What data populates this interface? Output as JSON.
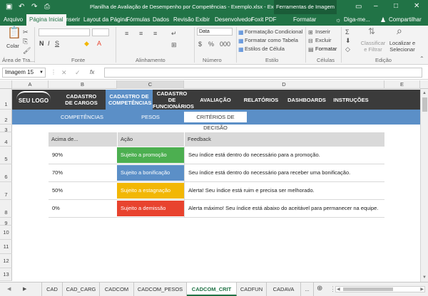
{
  "title_bar": {
    "document_title": "Planilha de Avaliação de Desempenho por Competências - Exemplo.xlsx - Excel",
    "context_tab": "Ferramentas de Imagem"
  },
  "ribbon_tabs": [
    "Arquivo",
    "Página Inicial",
    "Inserir",
    "Layout da Página",
    "Fórmulas",
    "Dados",
    "Revisão",
    "Exibir",
    "Desenvolvedor",
    "Foxit PDF",
    "Formatar"
  ],
  "tell_me": "Diga-me...",
  "share": "Compartilhar",
  "ribbon": {
    "paste": "Colar",
    "clipboard": "Área de Tra...",
    "font": "Fonte",
    "alignment": "Alinhamento",
    "number_format": "Data",
    "number": "Número",
    "cond_format": "Formatação Condicional",
    "format_table": "Formatar como Tabela",
    "cell_styles": "Estilos de Célula",
    "styles": "Estilo",
    "insert": "Inserir",
    "delete": "Excluir",
    "format": "Formatar",
    "cells": "Células",
    "sort_filter": "Classificar e Filtrar",
    "find_select": "Localizar e Selecionar",
    "editing": "Edição"
  },
  "formula_bar": {
    "name_box": "Imagem 15",
    "fx": "fx",
    "content": ""
  },
  "columns": [
    "A",
    "B",
    "C",
    "D",
    "E"
  ],
  "rows": [
    "1",
    "2",
    "3",
    "4",
    "5",
    "6",
    "7",
    "8",
    "9",
    "10",
    "11",
    "12",
    "13"
  ],
  "nav": {
    "logo": "SEU LOGO",
    "items": [
      "CADASTRO DE CARGOS",
      "CADASTRO DE COMPETÊNCIAS",
      "CADASTRO DE FUNCIONÁRIOS",
      "AVALIAÇÃO",
      "RELATÓRIOS",
      "DASHBOARDS",
      "INSTRUÇÕES"
    ]
  },
  "subnav": [
    "COMPETÊNCIAS",
    "PESOS",
    "CRITÉRIOS DE DECISÃO"
  ],
  "table": {
    "headers": [
      "Acima de...",
      "Ação",
      "Feedback"
    ],
    "rows": [
      {
        "above": "90%",
        "action": "Sujeito a promoção",
        "color": "#4caf50",
        "feedback": "Seu índice está dentro do necessário para a promoção."
      },
      {
        "above": "70%",
        "action": "Sujeito a bonificação",
        "color": "#5b8fc7",
        "feedback": "Seu índice está dentro do necessário para receber uma bonificação."
      },
      {
        "above": "50%",
        "action": "Sujeito a estagnação",
        "color": "#f2b705",
        "feedback": "Alerta! Seu índice está ruim e precisa ser melhorado."
      },
      {
        "above": "0%",
        "action": "Sujeito a demissão",
        "color": "#e8432e",
        "feedback": "Alerta máximo! Seu índice está abaixo do aceitável para permanecer na equipe."
      }
    ]
  },
  "sheets": [
    "CAD",
    "CAD_CARG",
    "CADCOM",
    "CADCOM_PESOS",
    "CADCOM_CRIT",
    "CADFUN",
    "CADAVA",
    "..."
  ],
  "colors": {
    "excel_green": "#217346",
    "nav_dark": "#3b3b3b",
    "subnav_blue": "#5b8fc7"
  }
}
